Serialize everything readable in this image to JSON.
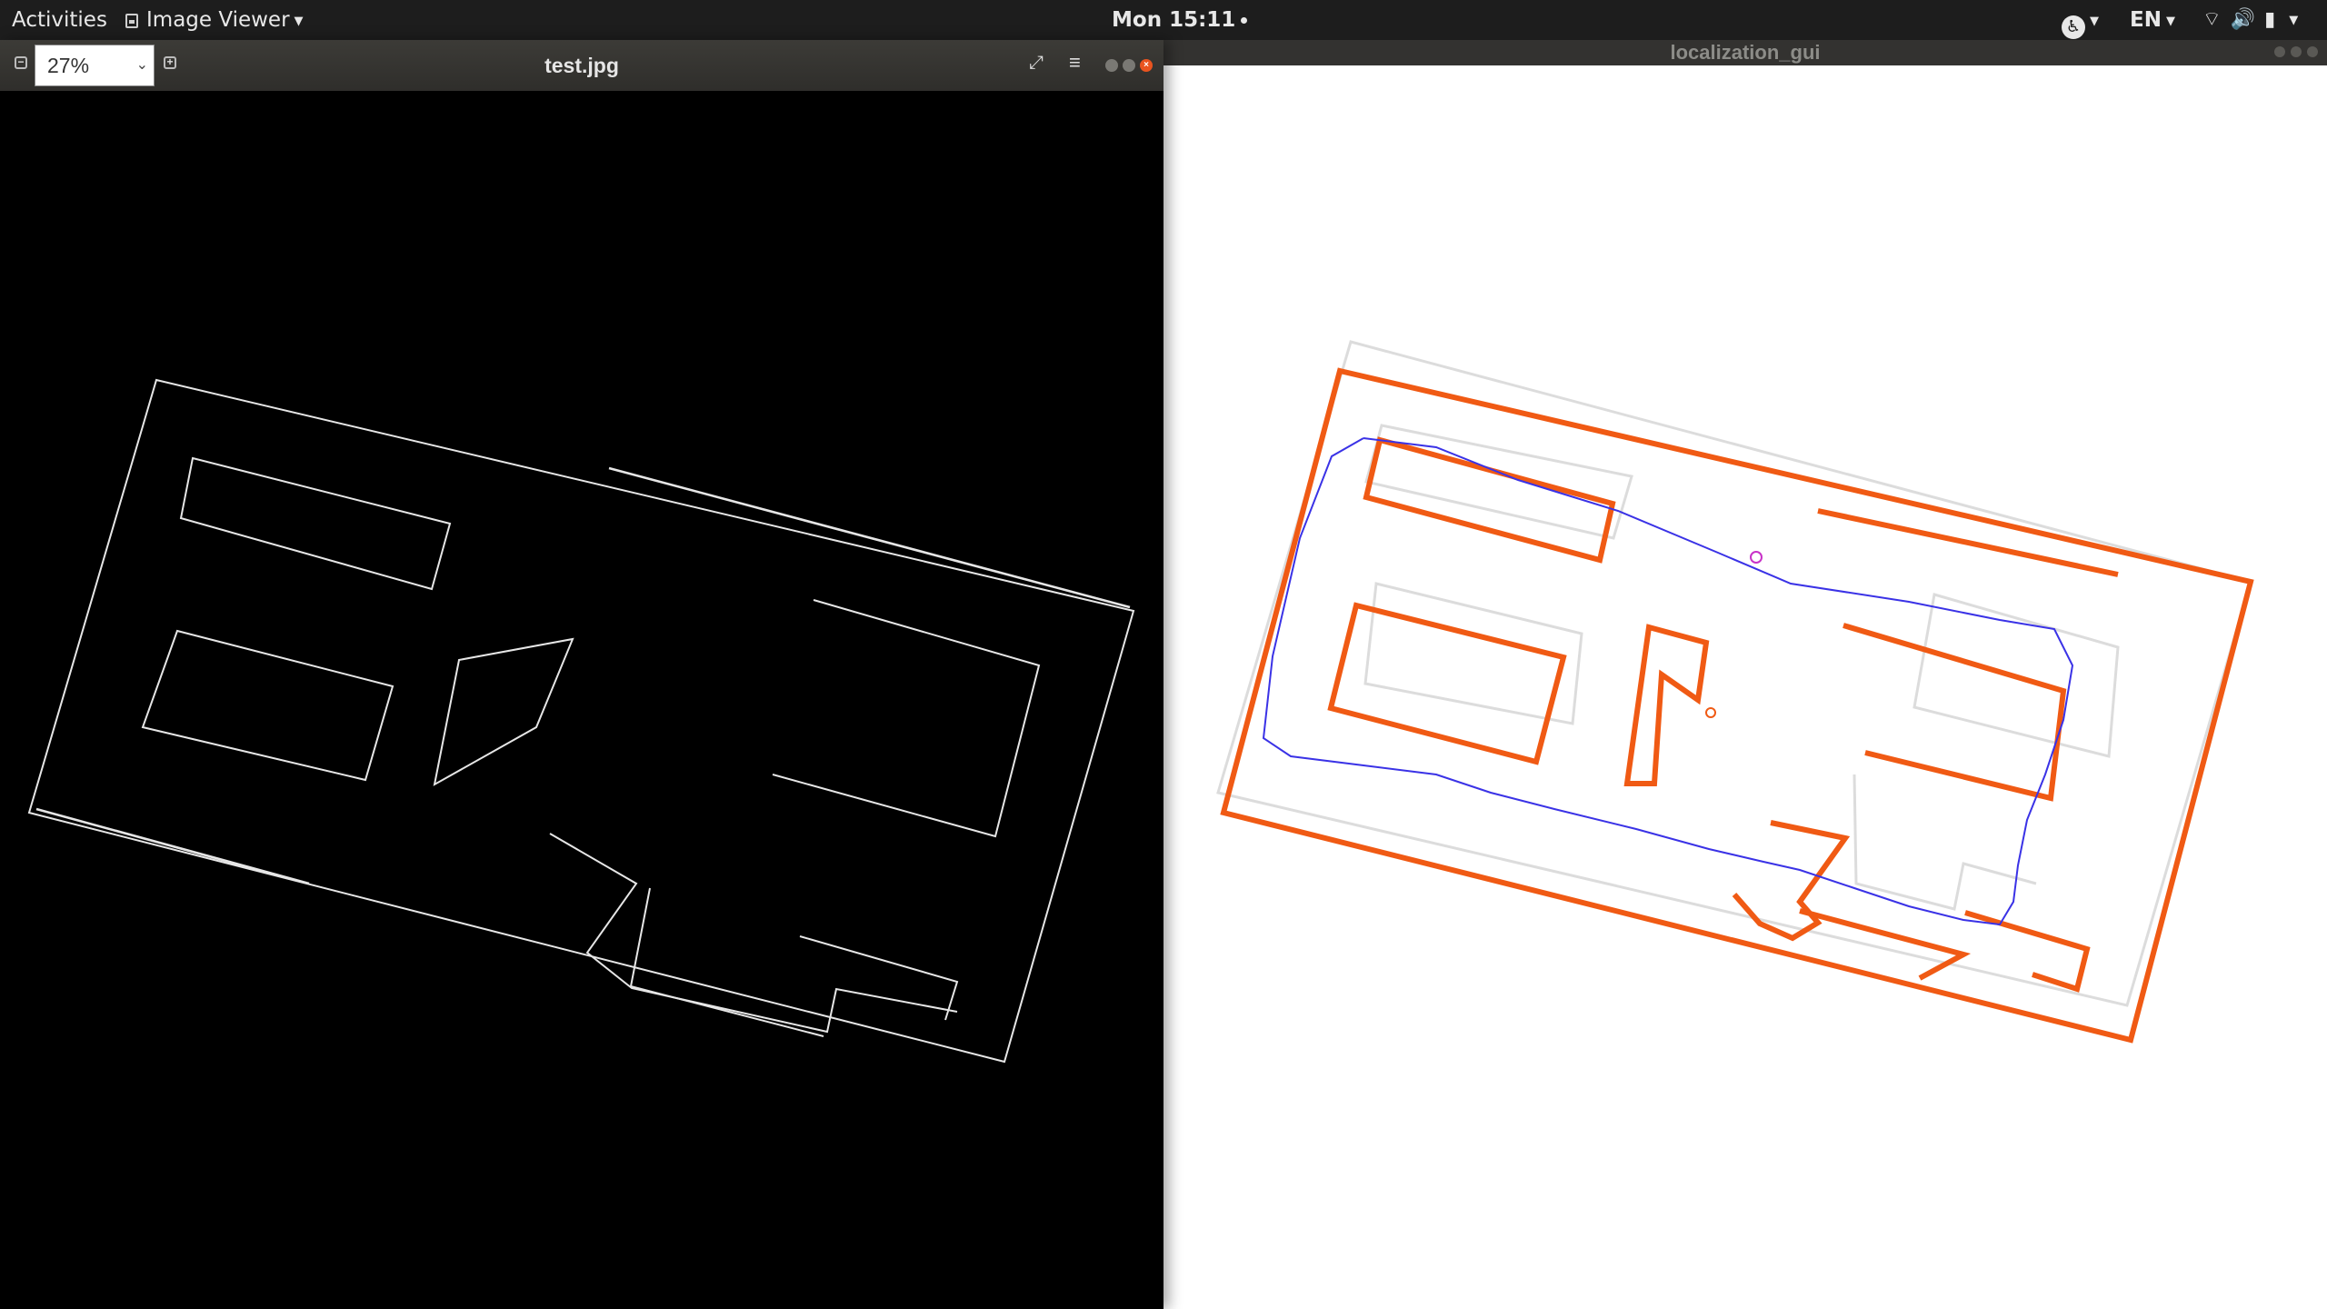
{
  "top_bar": {
    "activities": "Activities",
    "app_menu_label": "Image Viewer",
    "clock": "Mon 15:11",
    "language": "EN",
    "icons": [
      "accessibility-icon",
      "wifi-icon",
      "volume-icon",
      "battery-icon",
      "chevron-down-icon"
    ]
  },
  "image_viewer": {
    "title": "test.jpg",
    "zoom_value": "27%",
    "zoom_out_icon": "minus-icon",
    "zoom_in_icon": "plus-icon",
    "fullscreen_icon": "fullscreen-icon",
    "menu_icon": "hamburger-menu-icon",
    "canvas_background": "#000000",
    "edge_color": "#e6e6e6"
  },
  "localization_gui": {
    "title": "localization_gui",
    "map_color": "#f05a14",
    "reference_color": "#dcdcdc",
    "trajectory_color": "#3a32e6",
    "robot_marker_color": "#c832c8"
  }
}
